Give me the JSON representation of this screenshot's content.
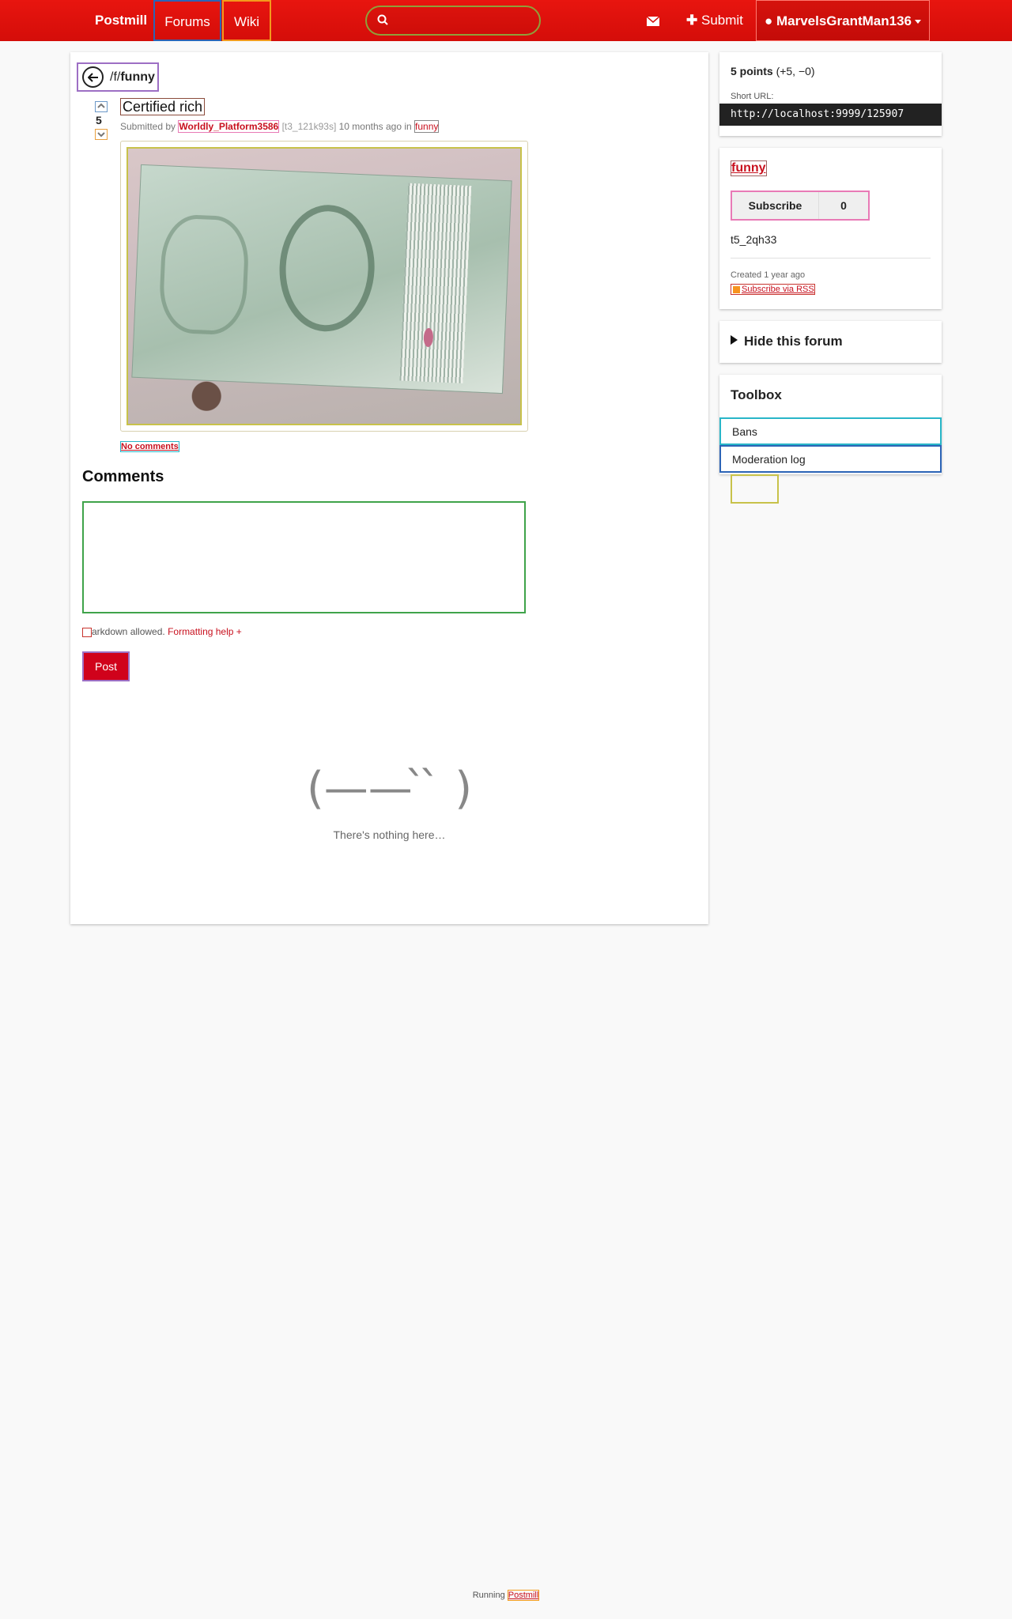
{
  "nav": {
    "brand": "Postmill",
    "forums": "Forums",
    "wiki": "Wiki",
    "search_value": "",
    "submit": "Submit",
    "user": "MarvelsGrantMan136"
  },
  "post": {
    "back_prefix": "/f/",
    "back_forum": "funny",
    "score": "5",
    "title": "Certified rich",
    "submitted_by": "Submitted by",
    "author": "Worldly_Platform3586",
    "post_id": "[t3_121k93s]",
    "time": "10 months ago in",
    "forum": "funny",
    "comments_link": "No comments"
  },
  "comments": {
    "heading": "Comments",
    "textarea_value": "",
    "markdown_note": "arkdown allowed.",
    "formatting_help": "Formatting help +",
    "post_button": "Post",
    "kaomoji": "(—— ̀ ̀ )",
    "empty_text": "There's nothing here…"
  },
  "sidebar": {
    "points": "5 points",
    "points_detail": "(+5, −0)",
    "short_url_label": "Short URL:",
    "short_url": "http://localhost:9999/125907",
    "forum_name": "funny",
    "subscribe": "Subscribe",
    "subscriber_count": "0",
    "forum_id": "t5_2qh33",
    "created": "Created 1 year ago",
    "rss": "Subscribe via RSS",
    "hide_forum": "Hide this forum",
    "toolbox_title": "Toolbox",
    "tools": [
      "Bans",
      "Moderation log"
    ]
  },
  "footer": {
    "running": "Running",
    "link": "Postmill"
  },
  "colors": {
    "brand_red": "#d40d09",
    "link_red": "#c8101e",
    "post_button": "#d0021b"
  }
}
